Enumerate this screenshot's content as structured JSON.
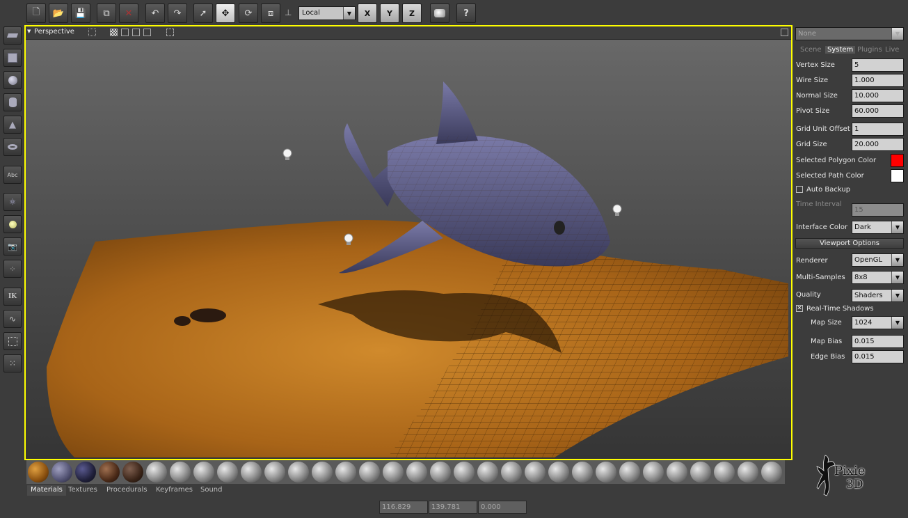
{
  "toolbar": {
    "coord_system": "Local",
    "axes": [
      "X",
      "Y",
      "Z"
    ]
  },
  "left_toolbar": {
    "text_tool": "Abc",
    "ik_tool": "IK"
  },
  "viewport": {
    "title": "Perspective"
  },
  "panel": {
    "preset": "None",
    "tabs": [
      "Scene",
      "System",
      "Plugins",
      "Live"
    ],
    "active_tab": "System",
    "vertex_size_label": "Vertex Size",
    "vertex_size": "5",
    "wire_size_label": "Wire Size",
    "wire_size": "1.000",
    "normal_size_label": "Normal Size",
    "normal_size": "10.000",
    "pivot_size_label": "Pivot Size",
    "pivot_size": "60.000",
    "grid_unit_offset_label": "Grid Unit Offset",
    "grid_unit_offset": "1",
    "grid_size_label": "Grid Size",
    "grid_size": "20.000",
    "selected_polygon_color_label": "Selected Polygon Color",
    "selected_polygon_color": "#ff0000",
    "selected_path_color_label": "Selected Path Color",
    "selected_path_color": "#ffffff",
    "auto_backup_label": "Auto Backup",
    "time_interval_label": "Time Interval",
    "time_interval": "15",
    "interface_color_label": "Interface Color",
    "interface_color": "Dark",
    "viewport_options_label": "Viewport Options",
    "renderer_label": "Renderer",
    "renderer": "OpenGL",
    "multi_samples_label": "Multi-Samples",
    "multi_samples": "8x8",
    "quality_label": "Quality",
    "quality": "Shaders",
    "realtime_shadows_label": "Real-Time Shadows",
    "realtime_shadows_check": "✕",
    "map_size_label": "Map Size",
    "map_size": "1024",
    "map_bias_label": "Map Bias",
    "map_bias": "0.015",
    "edge_bias_label": "Edge Bias",
    "edge_bias": "0.015"
  },
  "materials": {
    "tabs": [
      "Materials",
      "Textures",
      "Procedurals",
      "Keyframes",
      "Sound"
    ]
  },
  "coords": {
    "x": "116.829",
    "y": "139.781",
    "z": "0.000"
  },
  "logo": {
    "line1": "Pixie",
    "line2": "3D"
  }
}
